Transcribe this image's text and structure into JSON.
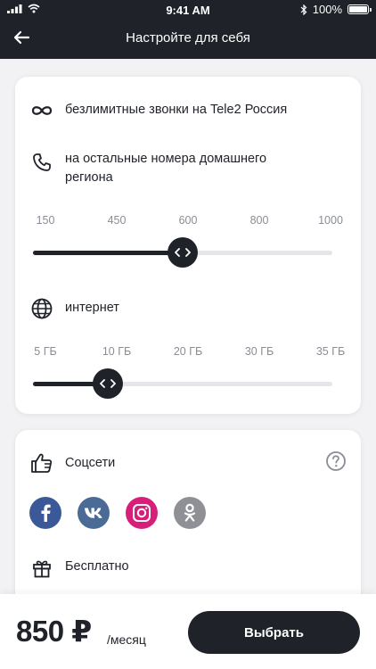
{
  "status_bar": {
    "time": "9:41 AM",
    "battery": "100%"
  },
  "header": {
    "title": "Настройте для себя"
  },
  "options": {
    "unlimited_calls": "безлимитные звонки на Tele2 Россия",
    "other_calls": "на остальные номера домашнего региона",
    "internet": "интернет"
  },
  "minutes_slider": {
    "ticks": [
      "150",
      "450",
      "600",
      "800",
      "1000"
    ],
    "selected_index": 2
  },
  "internet_slider": {
    "ticks": [
      "5 ГБ",
      "10 ГБ",
      "20 ГБ",
      "30 ГБ",
      "35 ГБ"
    ],
    "selected_index": 1
  },
  "social": {
    "title": "Соцсети",
    "free_label": "Бесплатно",
    "networks": [
      {
        "icon": "facebook-icon",
        "color": "#3b5998"
      },
      {
        "icon": "vk-icon",
        "color": "#4a6b96"
      },
      {
        "icon": "instagram-icon",
        "color": "#d61f7a"
      },
      {
        "icon": "odnoklassniki-icon",
        "color": "#8f9096"
      }
    ]
  },
  "footer": {
    "price": "850 ₽",
    "period": "/месяц",
    "cta": "Выбрать"
  },
  "colors": {
    "primary": "#1f2229",
    "track": "#e6e6ea",
    "background": "#f2f2f4"
  }
}
